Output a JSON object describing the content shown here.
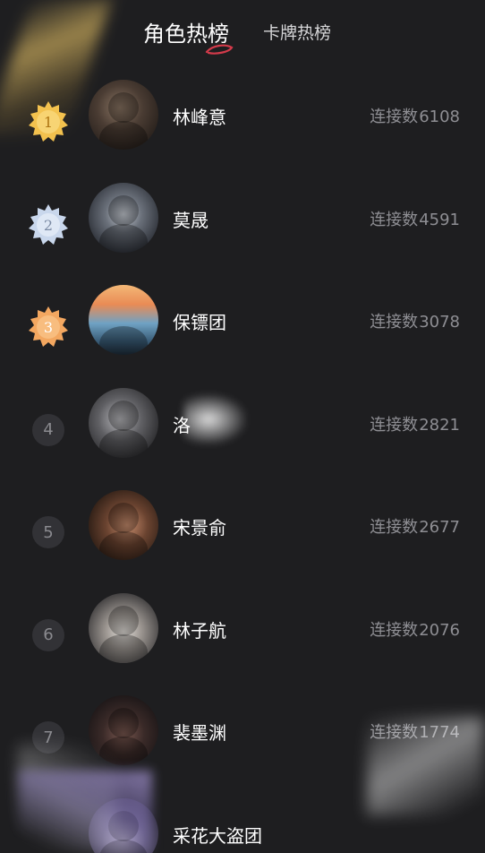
{
  "tabs": {
    "active": "角色热榜",
    "inactive": "卡牌热榜"
  },
  "colors": {
    "background": "#1e1e20",
    "gold_medal": "#f2c14e",
    "silver_medal": "#c9d7ec",
    "bronze_medal": "#f3a760",
    "count_text": "#8e8e93",
    "active_tab_underline": "#d23a4a"
  },
  "count_label": "连接数",
  "rows": [
    {
      "rank": "1",
      "medal": "gold",
      "name": "林峰意",
      "count": "6108",
      "avatar_icon": "avatar-portrait"
    },
    {
      "rank": "2",
      "medal": "silver",
      "name": "莫晟",
      "count": "4591",
      "avatar_icon": "avatar-portrait"
    },
    {
      "rank": "3",
      "medal": "bronze",
      "name": "保镖团",
      "count": "3078",
      "avatar_icon": "avatar-group-photo"
    },
    {
      "rank": "4",
      "medal": "none",
      "name": "洛",
      "count": "2821",
      "avatar_icon": "avatar-portrait"
    },
    {
      "rank": "5",
      "medal": "none",
      "name": "宋景俞",
      "count": "2677",
      "avatar_icon": "avatar-portrait"
    },
    {
      "rank": "6",
      "medal": "none",
      "name": "林子航",
      "count": "2076",
      "avatar_icon": "avatar-portrait"
    },
    {
      "rank": "7",
      "medal": "none",
      "name": "裴墨渊",
      "count": "1774",
      "avatar_icon": "avatar-portrait"
    },
    {
      "rank": "",
      "medal": "none",
      "name": "采花大盗团",
      "count": "",
      "avatar_icon": "avatar-portrait"
    }
  ]
}
